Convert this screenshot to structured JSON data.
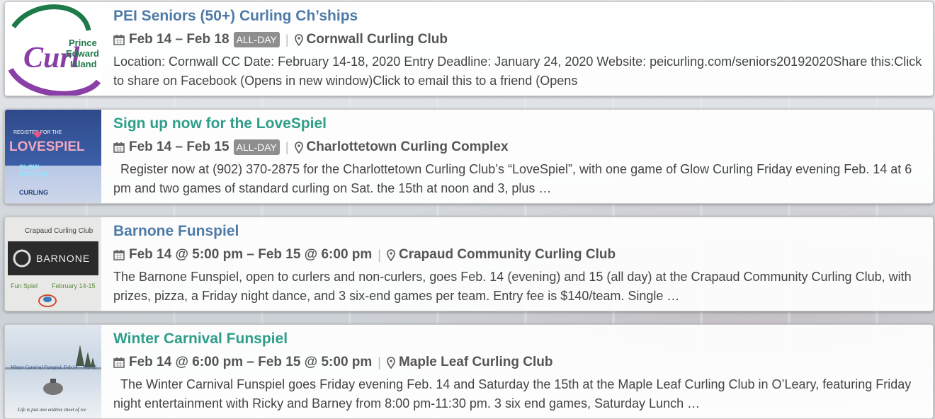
{
  "events": [
    {
      "title": "PEI Seniors (50+) Curling Ch’ships",
      "title_color": "#4e7aa6",
      "date": "Feb 14 – Feb 18",
      "all_day": "ALL-DAY",
      "venue": "Cornwall Curling Club",
      "description": "Location: Cornwall CC Date: February 14-18, 2020 Entry Deadline: January 24, 2020 Website: peicurling.com/seniors20192020Share this:Click to share on Facebook (Opens in new window)Click to email this to a friend (Opens",
      "thumb": {
        "logo_word": "Curl",
        "logo_sub1": "Prince",
        "logo_sub2": "Edward",
        "logo_sub3": "Island"
      }
    },
    {
      "title": "Sign up now for the LoveSpiel",
      "title_color": "#2e9e8a",
      "date": "Feb 14 – Feb 15",
      "all_day": "ALL-DAY",
      "venue": "Charlottetown Curling Complex",
      "description": "  Register now at (902) 370-2875 for the Charlottetown Curling Club’s “LoveSpiel”, with one game of Glow Curling Friday evening Feb. 14 at 6 pm and two games of standard curling on Sat. the 15th at noon and 3, plus …",
      "thumb": {
        "line1": "REGISTER FOR THE",
        "line2": "LOVESPIEL",
        "line3": "GLOW",
        "line4": "CURLING",
        "line5": "CURLING"
      }
    },
    {
      "title": "Barnone Funspiel",
      "title_color": "#4e7aa6",
      "date": "Feb 14 @ 5:00 pm – Feb 15 @ 6:00 pm",
      "all_day": "",
      "venue": "Crapaud Community Curling Club",
      "description": "The Barnone Funspiel, open to curlers and non-curlers, goes Feb. 14 (evening) and 15 (all day) at the Crapaud Community Curling Club, with prizes, pizza, a Friday night dance, and 3 six-end games per team. Entry fee is $140/team. Single …",
      "thumb": {
        "line1": "Crapaud Curling Club",
        "line2": "BARNONE",
        "line3": "Fun Spiel",
        "line4": "February 14-15"
      }
    },
    {
      "title": "Winter Carnival Funspiel",
      "title_color": "#2e9e8a",
      "date": "Feb 14 @ 6:00 pm – Feb 15 @ 5:00 pm",
      "all_day": "",
      "venue": "Maple Leaf Curling Club",
      "description": "  The Winter Carnival Funspiel goes Friday evening Feb. 14 and Saturday the 15th at the Maple Leaf Curling Club in O’Leary, featuring Friday night entertainment with Ricky and Barney from 8:00 pm-11:30 pm. 3 six end games, Saturday Lunch …",
      "thumb": {
        "line1": "Winter Carnival Funspiel, Feb 14 – Feb 15",
        "line2": "Life is just one endless sheet of ice"
      }
    }
  ]
}
